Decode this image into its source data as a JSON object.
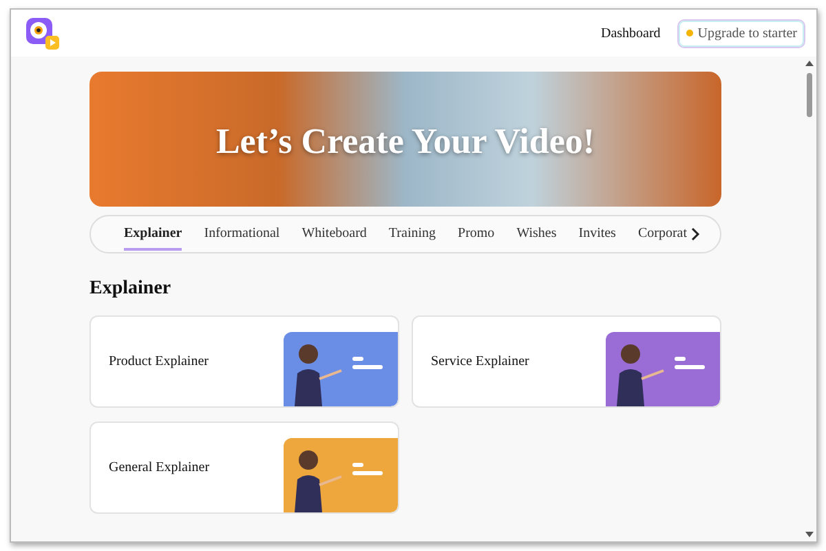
{
  "header": {
    "nav_link": "Dashboard",
    "upgrade_button": "Upgrade to starter"
  },
  "banner": {
    "title": "Let’s Create Your Video!"
  },
  "tabs": [
    {
      "label": "Explainer",
      "selected": true
    },
    {
      "label": "Informational",
      "selected": false
    },
    {
      "label": "Whiteboard",
      "selected": false
    },
    {
      "label": "Training",
      "selected": false
    },
    {
      "label": "Promo",
      "selected": false
    },
    {
      "label": "Wishes",
      "selected": false
    },
    {
      "label": "Invites",
      "selected": false
    },
    {
      "label": "Corporat",
      "selected": false
    }
  ],
  "section": {
    "title": "Explainer",
    "cards": [
      {
        "title": "Product Explainer",
        "color": "#6a8de6"
      },
      {
        "title": "Service Explainer",
        "color": "#9a6cd6"
      },
      {
        "title": "General Explainer",
        "color": "#eea73c"
      }
    ]
  }
}
